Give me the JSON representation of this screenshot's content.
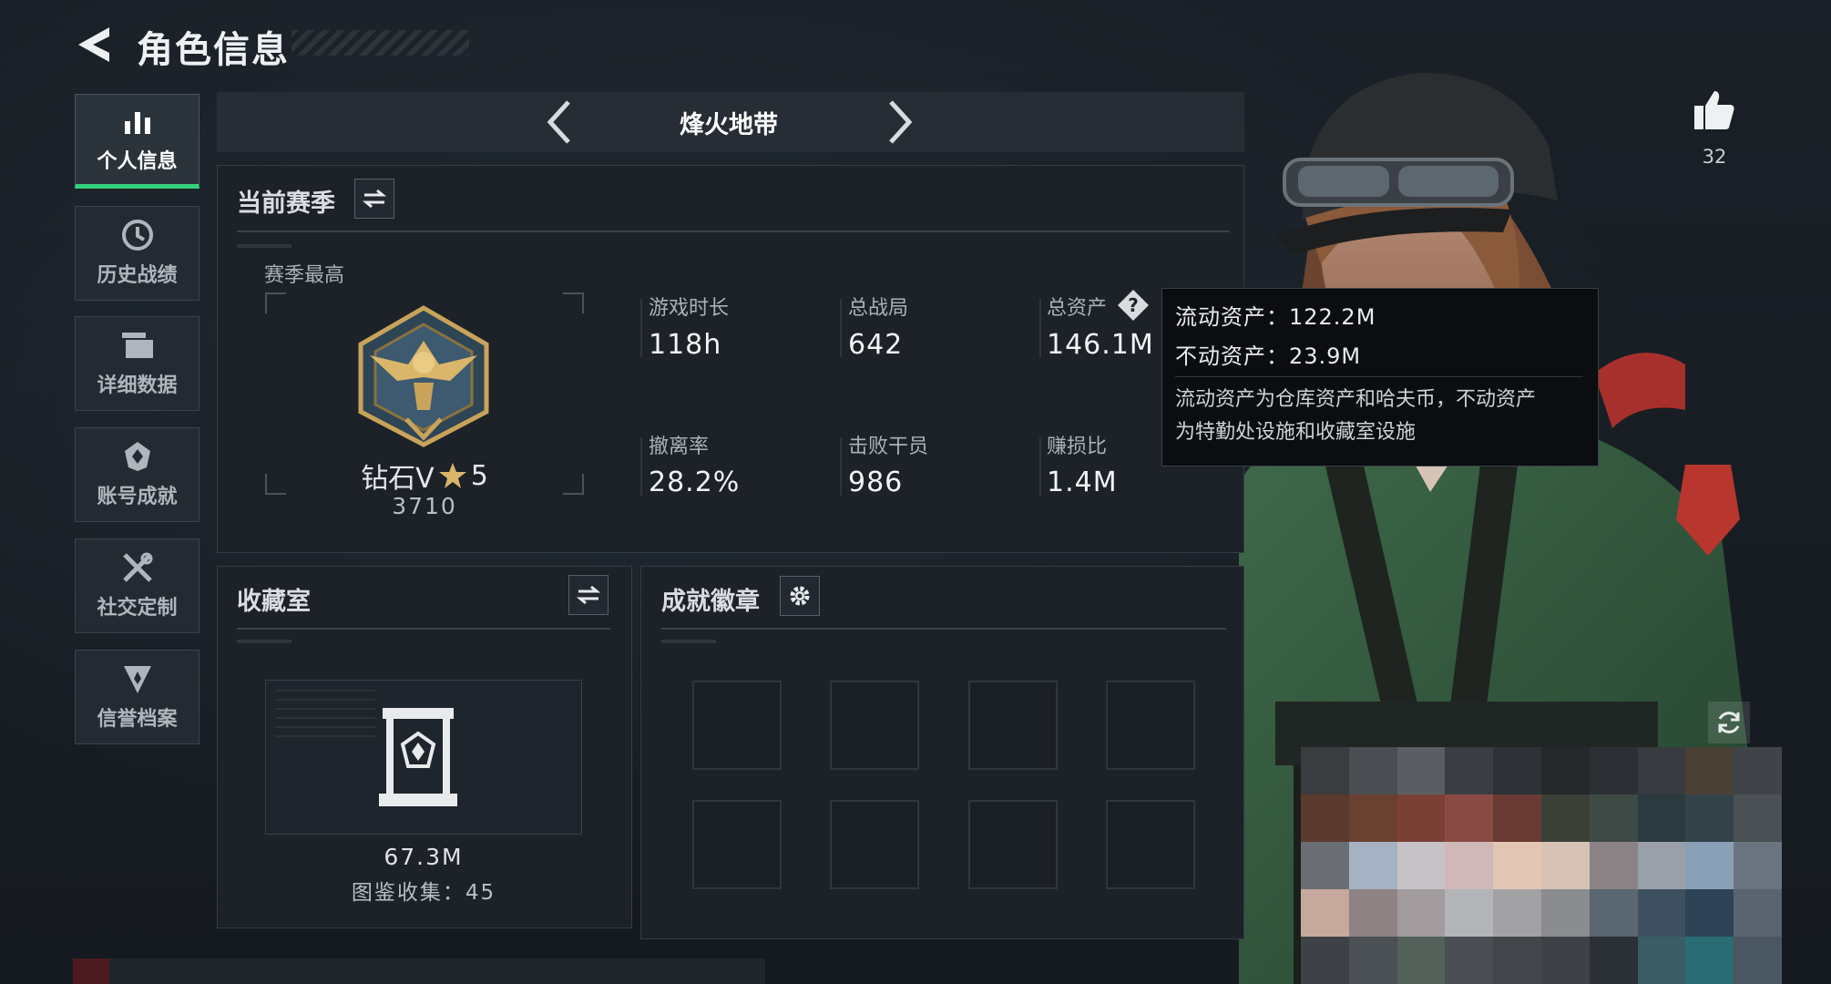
{
  "header": {
    "title": "角色信息"
  },
  "sidebar": {
    "items": [
      {
        "label": "个人信息",
        "icon": "bar-chart-icon",
        "active": true
      },
      {
        "label": "历史战绩",
        "icon": "history-clock-icon",
        "active": false
      },
      {
        "label": "详细数据",
        "icon": "stacked-cards-icon",
        "active": false
      },
      {
        "label": "账号成就",
        "icon": "achievement-emblem-icon",
        "active": false
      },
      {
        "label": "社交定制",
        "icon": "crossed-tools-icon",
        "active": false
      },
      {
        "label": "信誉档案",
        "icon": "reputation-shield-icon",
        "active": false
      }
    ]
  },
  "mode": {
    "name": "烽火地带"
  },
  "season": {
    "title": "当前赛季",
    "best_label": "赛季最高",
    "rank_name": "钻石V",
    "rank_stars": "5",
    "rank_score": "3710",
    "stats": [
      {
        "label": "游戏时长",
        "value": "118h"
      },
      {
        "label": "总战局",
        "value": "642"
      },
      {
        "label": "总资产",
        "value": "146.1M"
      },
      {
        "label": "撤离率",
        "value": "28.2%"
      },
      {
        "label": "击败干员",
        "value": "986"
      },
      {
        "label": "赚损比",
        "value": "1.4M"
      }
    ]
  },
  "tooltip": {
    "liquid": "流动资产：122.2M",
    "fixed": "不动资产：23.9M",
    "desc_line1": "流动资产为仓库资产和哈夫币，不动资产",
    "desc_line2": "为特勤处设施和收藏室设施"
  },
  "collection": {
    "title": "收藏室",
    "value": "67.3M",
    "catalog": "图鉴收集：45"
  },
  "badges": {
    "title": "成就徽章",
    "slots": 8
  },
  "likes": {
    "count": "32"
  },
  "colors": {
    "accent": "#35d07a",
    "panel": "#1c2228",
    "background": "#161b21",
    "medal_gold": "#c9a35a"
  }
}
